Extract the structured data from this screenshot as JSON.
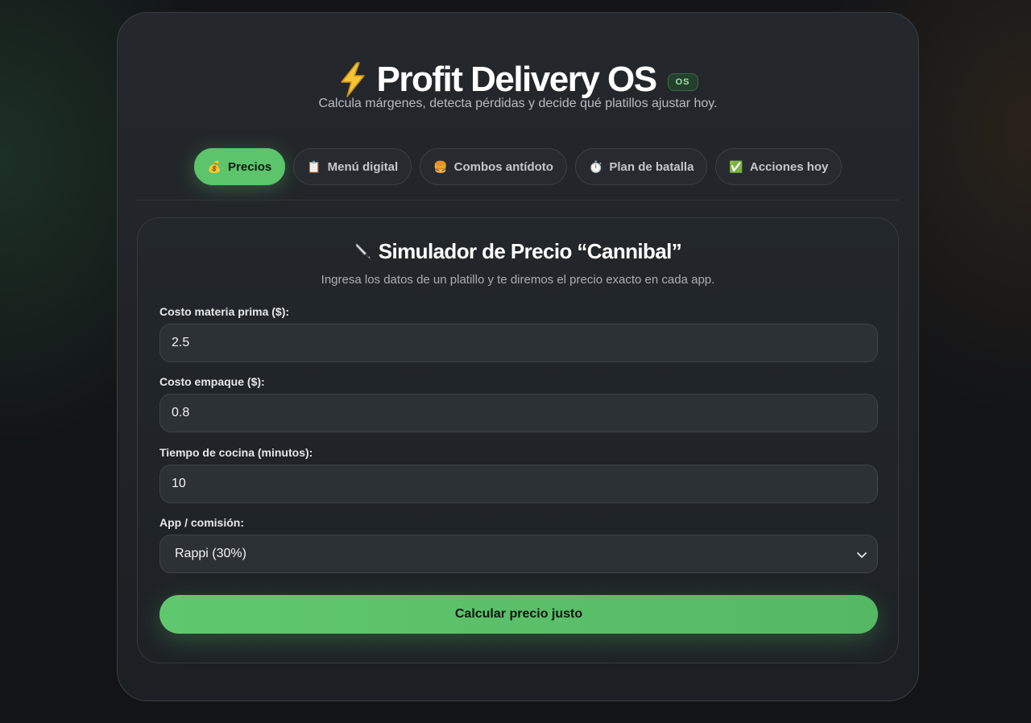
{
  "header": {
    "title": "Profit Delivery OS",
    "badge": "OS",
    "subtitle": "Calcula márgenes, detecta pérdidas y decide qué platillos ajustar hoy."
  },
  "tabs": [
    {
      "icon": "💰",
      "label": "Precios",
      "active": true
    },
    {
      "icon": "📋",
      "label": "Menú digital",
      "active": false
    },
    {
      "icon": "🍔",
      "label": "Combos antídoto",
      "active": false
    },
    {
      "icon": "⏱️",
      "label": "Plan de batalla",
      "active": false
    },
    {
      "icon": "✅",
      "label": "Acciones hoy",
      "active": false
    }
  ],
  "simulator": {
    "title": "Simulador de Precio “Cannibal”",
    "subtitle": "Ingresa los datos de un platillo y te diremos el precio exacto en cada app.",
    "fields": {
      "raw_cost": {
        "label": "Costo materia prima ($):",
        "value": "2.5"
      },
      "packaging_cost": {
        "label": "Costo empaque ($):",
        "value": "0.8"
      },
      "cook_time": {
        "label": "Tiempo de cocina (minutos):",
        "value": "10"
      },
      "app_commission": {
        "label": "App / comisión:",
        "selected": "Rappi (30%)"
      }
    },
    "button_label": "Calcular precio justo"
  },
  "colors": {
    "accent": "#5cc46b",
    "background": "#121417",
    "card": "#22262a"
  }
}
